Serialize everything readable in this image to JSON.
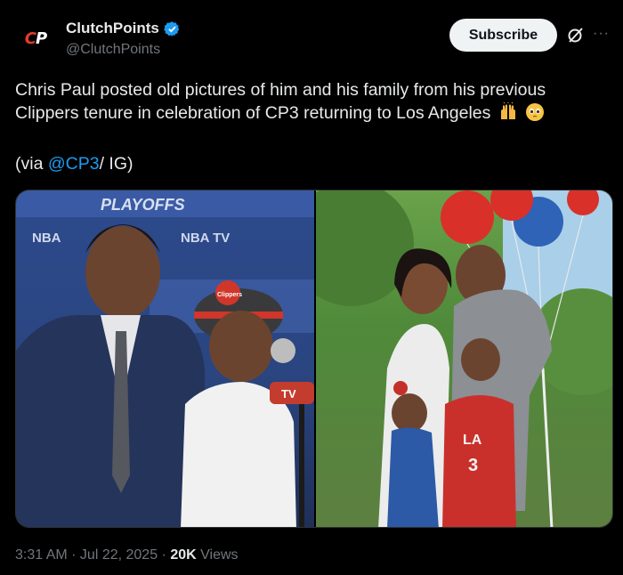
{
  "account": {
    "logo_text_c": "C",
    "logo_text_p": "P",
    "display_name": "ClutchPoints",
    "handle": "@ClutchPoints"
  },
  "actions": {
    "subscribe_label": "Subscribe",
    "more_label": "···"
  },
  "tweet": {
    "line1": "Chris Paul posted old pictures of him and his family from his previous",
    "line2": "Clippers tenure in celebration of CP3 returning to Los Angeles",
    "via_prefix": "(via ",
    "via_mention": "@CP3",
    "via_suffix": "/ IG)"
  },
  "media": {
    "left_banner": "PLAYOFFS",
    "left_sub1": "NBA",
    "left_sub2": "NBA TV",
    "cap_logo": "Clippers",
    "mic_label": "TV",
    "jersey_text": "LA",
    "jersey_number": "3"
  },
  "meta": {
    "time": "3:31 AM",
    "date": "Jul 22, 2025",
    "views_count": "20K",
    "views_label": "Views"
  },
  "colors": {
    "background": "#000000",
    "text": "#e7e9ea",
    "muted": "#71767b",
    "accent": "#1d9bf0",
    "brand_red": "#e23b2e"
  },
  "icons": {
    "verified": "verified-badge-icon",
    "grok": "grok-icon",
    "more": "more-options-icon",
    "emoji1": "raised-hands-emoji-icon",
    "emoji2": "teary-face-emoji-icon"
  }
}
